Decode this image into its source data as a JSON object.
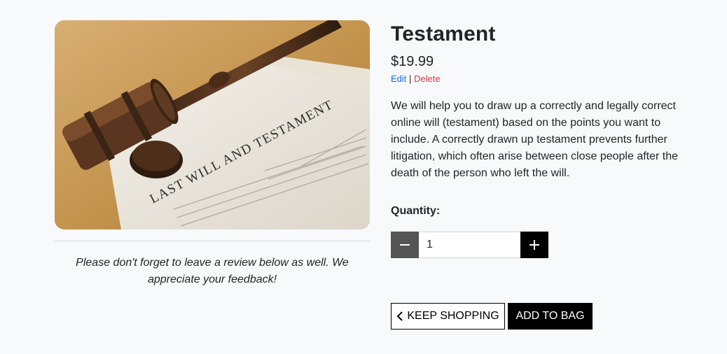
{
  "product": {
    "image_alt": "Gavel resting on a Last Will and Testament document",
    "image_text": "LAST WILL AND TESTAMENT",
    "title": "Testament",
    "price": "$19.99",
    "edit_label": "Edit",
    "separator": "|",
    "delete_label": "Delete",
    "description": "We will help you to draw up a correctly and legally correct online will (testament) based on the points you want to include. A correctly drawn up testament prevents further litigation, which often arise between close people after the death of the person who left the will."
  },
  "review_note": "Please don't forget to leave a review below as well. We appreciate your feedback!",
  "quantity": {
    "label": "Quantity:",
    "value": "1",
    "decrement_icon": "minus-icon",
    "increment_icon": "plus-icon"
  },
  "actions": {
    "keep_shopping_label": "KEEP SHOPPING",
    "keep_shopping_icon": "chevron-left-icon",
    "add_to_bag_label": "ADD TO BAG"
  },
  "colors": {
    "background": "#f8f9fa",
    "edit_link": "#0d6efd",
    "delete_link": "#dc3545",
    "primary_button": "#000000",
    "minus_button": "#555555"
  }
}
